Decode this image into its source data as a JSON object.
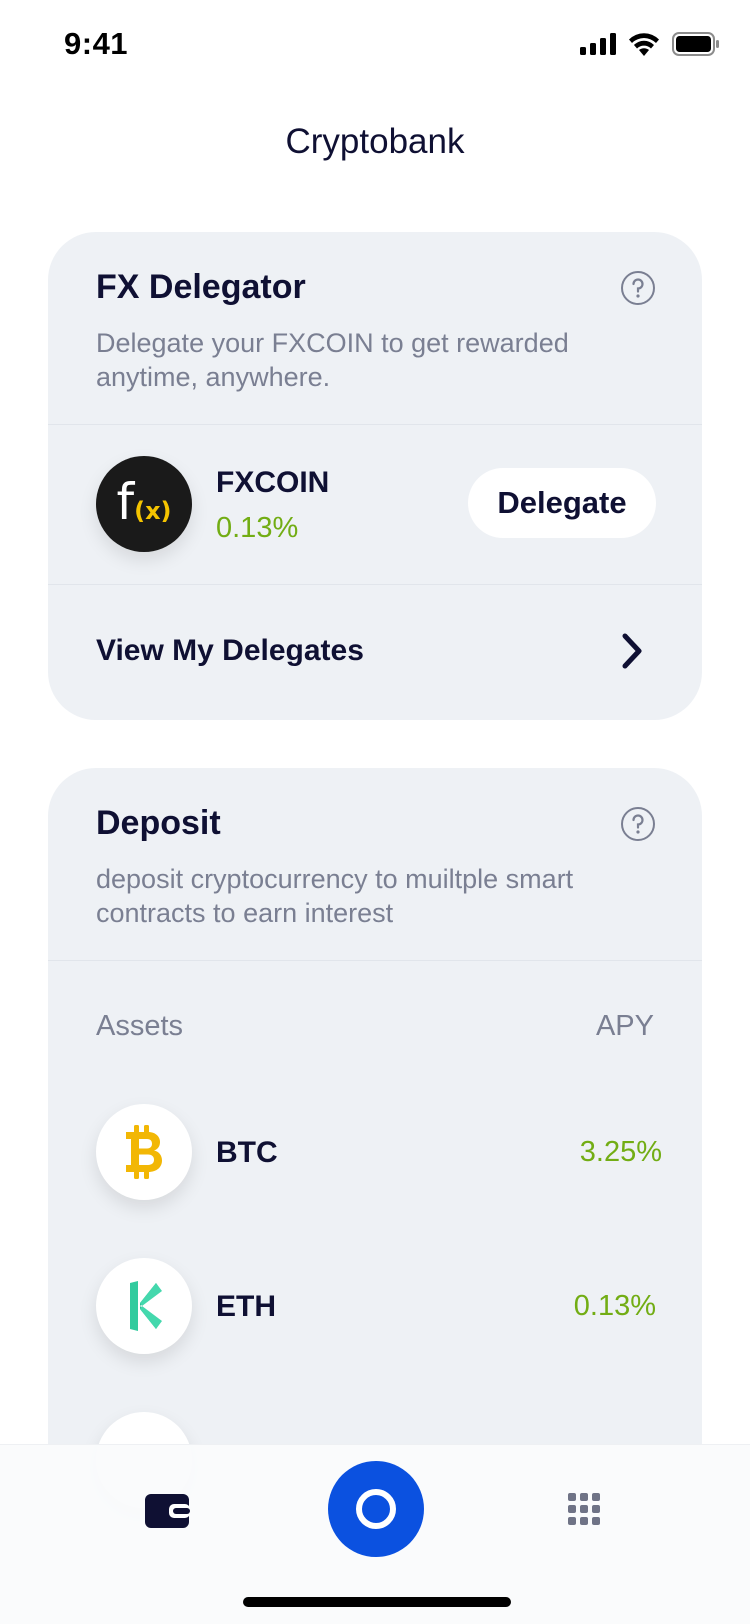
{
  "status_bar": {
    "time": "9:41"
  },
  "app": {
    "title": "Cryptobank"
  },
  "fx_card": {
    "title": "FX Delegator",
    "description": "Delegate your FXCOIN to get rewarded anytime, anywhere.",
    "coin": {
      "name": "FXCOIN",
      "rate": "0.13%",
      "logo_main": "f",
      "logo_sub": "(x)"
    },
    "delegate_label": "Delegate",
    "view_label": "View My Delegates"
  },
  "deposit_card": {
    "title": "Deposit",
    "description": "deposit cryptocurrency to muiltple smart contracts to earn interest",
    "assets_header": "Assets",
    "apy_header": "APY",
    "assets": [
      {
        "name": "BTC",
        "apy": "3.25%",
        "icon": "bitcoin-icon"
      },
      {
        "name": "ETH",
        "apy": "0.13%",
        "icon": "kyber-icon"
      }
    ]
  },
  "tab_bar": {
    "items": [
      "wallet-icon",
      "center-action-icon",
      "apps-grid-icon"
    ]
  },
  "colors": {
    "accent": "#0b51e0",
    "positive": "#72ad14",
    "bitcoin": "#f2b705",
    "kyber": "#31cb9e",
    "card_bg": "#eef1f5"
  }
}
